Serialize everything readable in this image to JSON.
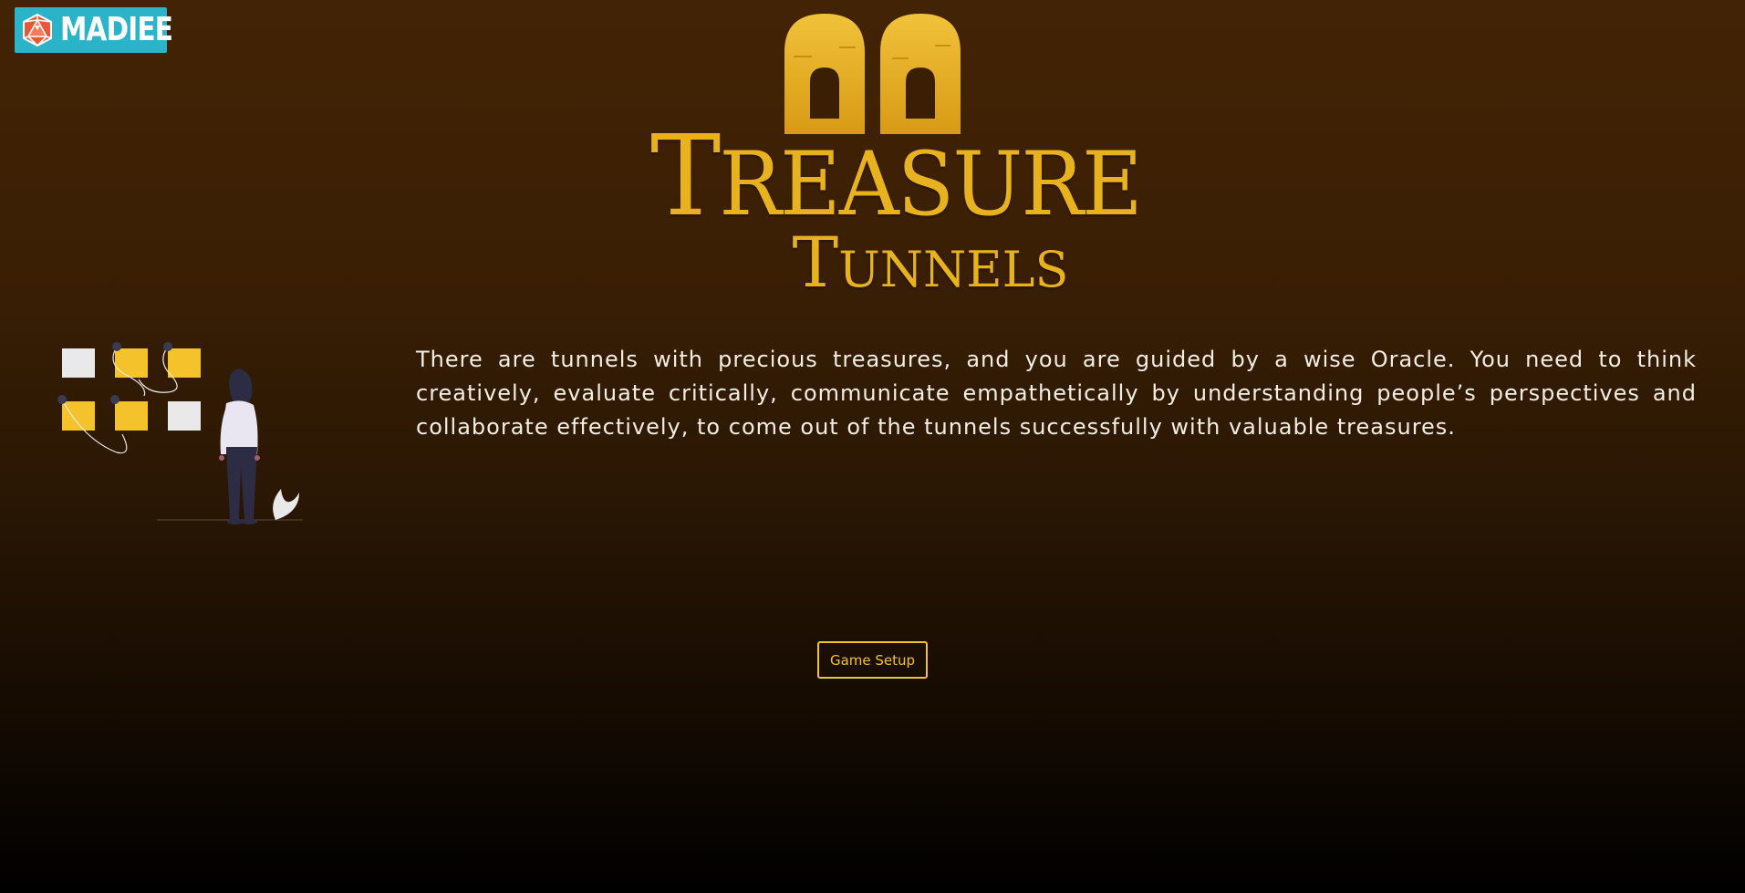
{
  "brand": {
    "name": "MADIEE",
    "icon": "d20-dice-icon",
    "bg_color": "#2bb3c9"
  },
  "logo": {
    "line1_initial": "T",
    "line1_rest": "REASURE",
    "line2_initial": "T",
    "line2_rest": "UNNELS",
    "line2_final": "S",
    "color": "#e8b21f"
  },
  "illustration": {
    "icon": "person-viewing-board-illustration"
  },
  "main": {
    "description": "There are tunnels with precious treasures, and you are guided by a wise Oracle. You need to think creatively, evaluate critically, communicate empathetically by understanding people’s perspectives and collaborate effectively, to come out of the tunnels successfully with valuable treasures."
  },
  "actions": {
    "game_setup_label": "Game Setup",
    "accent_color": "#f2c230"
  }
}
